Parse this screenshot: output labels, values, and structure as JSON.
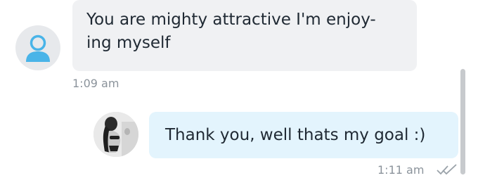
{
  "messages": [
    {
      "direction": "incoming",
      "avatar": "default-user-icon",
      "text_line1": "You are mighty attractive I'm enjoy-",
      "text_line2": "ing myself",
      "time": "1:09 am"
    },
    {
      "direction": "outgoing",
      "avatar": "profile-photo",
      "text": "Thank you, well thats my goal :)",
      "time": "1:11 am",
      "status_icon": "double-check-icon"
    }
  ],
  "colors": {
    "incoming_bubble": "#f0f1f3",
    "outgoing_bubble": "#e3f4fd",
    "avatar_icon": "#49b4e8",
    "timestamp": "#8b939b",
    "text": "#1f2933"
  }
}
